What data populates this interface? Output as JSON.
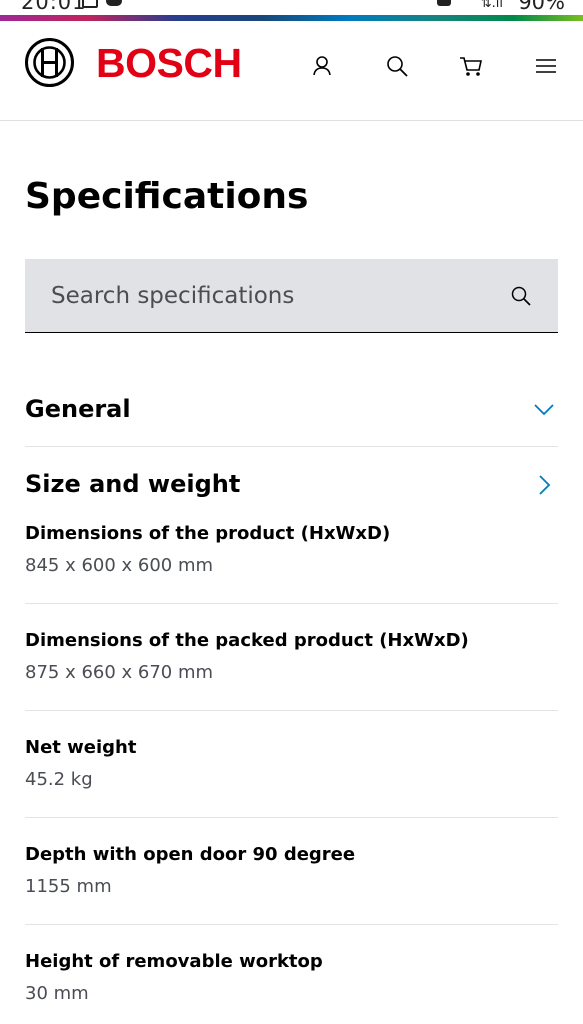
{
  "status_bar": {
    "time": "20:01",
    "battery": "90%"
  },
  "brand": {
    "logo_text": "BOSCH",
    "accent": "#e20015"
  },
  "header_icons": [
    "user-icon",
    "search-icon",
    "cart-icon",
    "menu-icon"
  ],
  "page": {
    "title": "Specifications"
  },
  "search": {
    "placeholder": "Search specifications"
  },
  "sections": {
    "general": {
      "title": "General",
      "state": "expanded"
    },
    "size_weight": {
      "title": "Size and weight",
      "state": "collapsed"
    }
  },
  "specs": [
    {
      "label": "Dimensions of the product (HxWxD)",
      "value": "845 x 600 x 600 mm"
    },
    {
      "label": "Dimensions of the packed product (HxWxD)",
      "value": "875 x 660 x 670 mm"
    },
    {
      "label": "Net weight",
      "value": "45.2 kg"
    },
    {
      "label": "Depth with open door 90 degree",
      "value": "1155 mm"
    },
    {
      "label": "Height of removable worktop",
      "value": "30 mm"
    }
  ]
}
